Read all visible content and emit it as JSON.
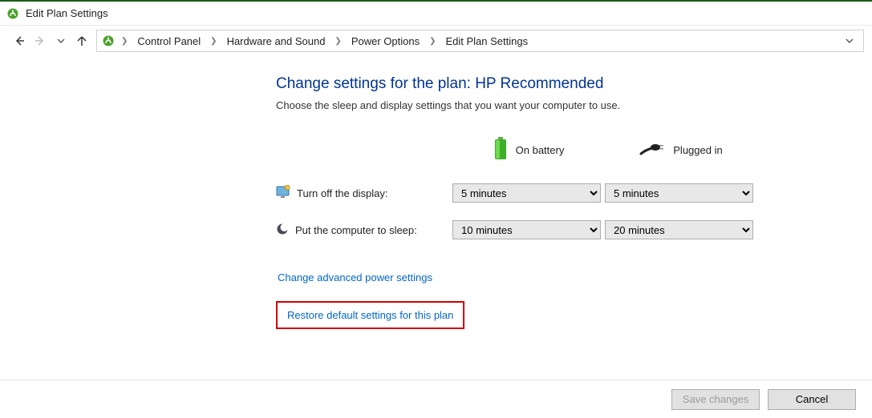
{
  "window": {
    "title": "Edit Plan Settings"
  },
  "breadcrumb": {
    "items": [
      "Control Panel",
      "Hardware and Sound",
      "Power Options",
      "Edit Plan Settings"
    ]
  },
  "page": {
    "heading": "Change settings for the plan: HP Recommended",
    "sub": "Choose the sleep and display settings that you want your computer to use.",
    "col_battery": "On battery",
    "col_plugged": "Plugged in",
    "row_display": "Turn off the display:",
    "row_sleep": "Put the computer to sleep:",
    "display_battery": "5 minutes",
    "display_plugged": "5 minutes",
    "sleep_battery": "10 minutes",
    "sleep_plugged": "20 minutes",
    "link_advanced": "Change advanced power settings",
    "link_restore": "Restore default settings for this plan"
  },
  "footer": {
    "save": "Save changes",
    "cancel": "Cancel"
  }
}
